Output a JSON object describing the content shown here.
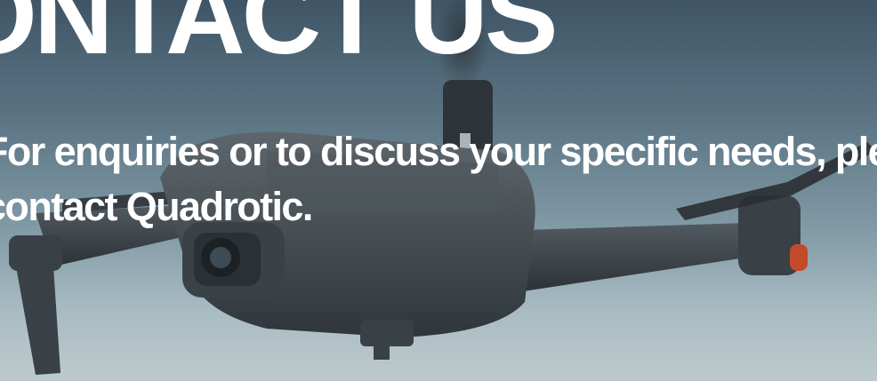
{
  "hero": {
    "title": "CONTACT US",
    "subtitle_lines": [
      "For enquiries or to discuss your specific needs, please",
      "contact Quadrotic."
    ],
    "image_subject": "drone in flight"
  },
  "colors": {
    "sky_top": "#3f5566",
    "sky_bottom": "#bdcacd",
    "drone_body": "#3a4146",
    "text": "#ffffff"
  }
}
